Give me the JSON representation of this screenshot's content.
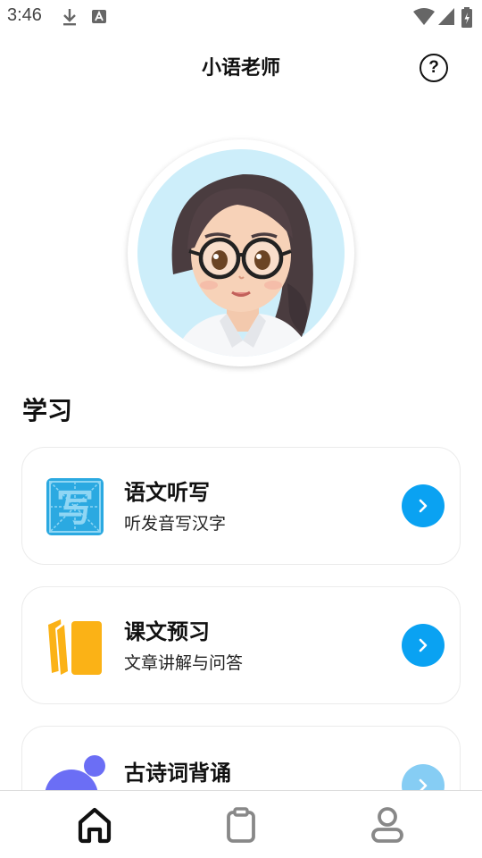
{
  "status_bar": {
    "time": "3:46",
    "icons": [
      "download-icon",
      "font-notification-icon",
      "wifi-icon",
      "signal-icon",
      "battery-icon"
    ]
  },
  "header": {
    "title": "小语老师",
    "help_label": "?"
  },
  "avatar": {
    "description_icon": "teacher-avatar"
  },
  "section": {
    "title": "学习"
  },
  "cards": [
    {
      "title": "语文听写",
      "subtitle": "听发音写汉字",
      "icon": "dictation-icon",
      "accent": "#2ba9e1"
    },
    {
      "title": "课文预习",
      "subtitle": "文章讲解与问答",
      "icon": "book-icon",
      "accent": "#fbb216"
    },
    {
      "title": "古诗词背诵",
      "subtitle": "",
      "icon": "poem-icon",
      "accent": "#6b6ef5"
    }
  ],
  "colors": {
    "arrow_button": "#0aa2f2",
    "arrow_button_faded": "#86cdf4"
  },
  "bottom_nav": {
    "items": [
      "home-icon",
      "clipboard-icon",
      "profile-icon"
    ],
    "active": "home-icon"
  }
}
